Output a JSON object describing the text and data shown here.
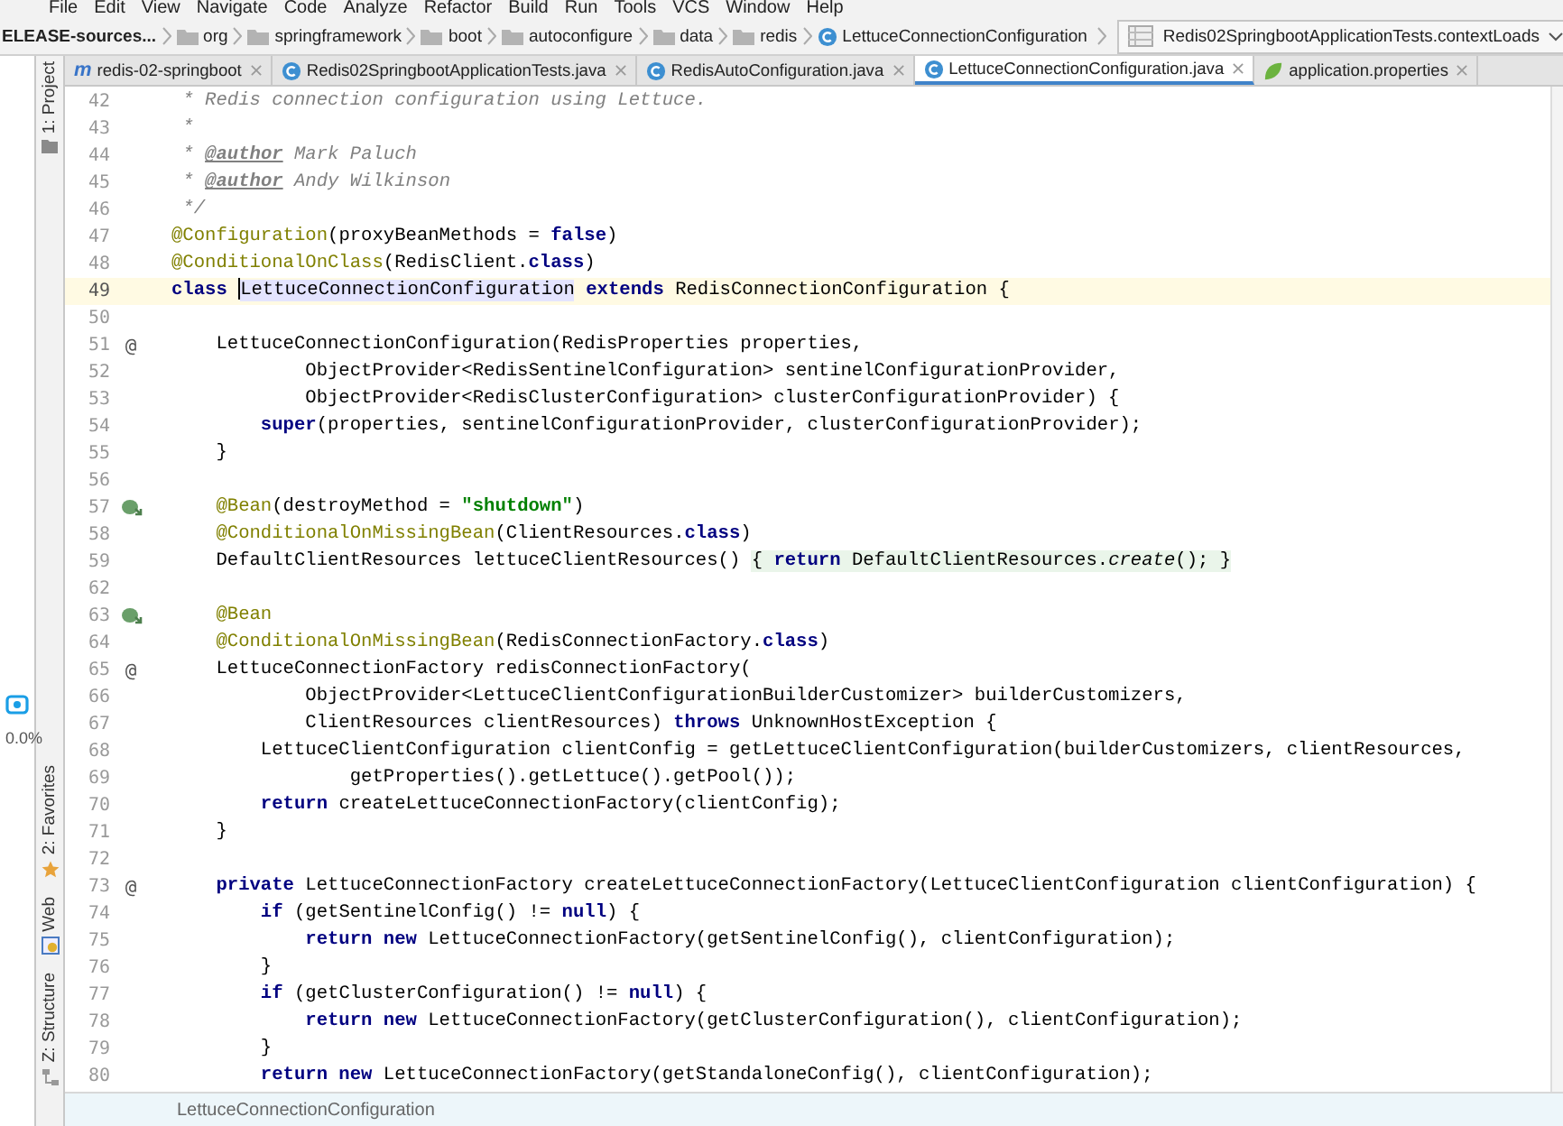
{
  "menu": [
    "File",
    "Edit",
    "View",
    "Navigate",
    "Code",
    "Analyze",
    "Refactor",
    "Build",
    "Run",
    "Tools",
    "VCS",
    "Window",
    "Help"
  ],
  "breadcrumb": [
    {
      "kind": "root",
      "text": "ELEASE-sources..."
    },
    {
      "kind": "folder",
      "text": "org"
    },
    {
      "kind": "folder",
      "text": "springframework"
    },
    {
      "kind": "folder",
      "text": "boot"
    },
    {
      "kind": "folder",
      "text": "autoconfigure"
    },
    {
      "kind": "folder",
      "text": "data"
    },
    {
      "kind": "folder",
      "text": "redis"
    },
    {
      "kind": "class",
      "text": "LettuceConnectionConfiguration"
    }
  ],
  "run_config": "Redis02SpringbootApplicationTests.contextLoads",
  "tabs": [
    {
      "kind": "module",
      "glyph": "m",
      "label": "redis-02-springboot",
      "selected": false
    },
    {
      "kind": "class",
      "label": "Redis02SpringbootApplicationTests.java",
      "selected": false
    },
    {
      "kind": "class",
      "label": "RedisAutoConfiguration.java",
      "selected": false
    },
    {
      "kind": "class",
      "label": "LettuceConnectionConfiguration.java",
      "selected": true
    },
    {
      "kind": "properties",
      "label": "application.properties",
      "selected": false
    }
  ],
  "tool_windows": [
    {
      "kind": "project",
      "label": "1: Project"
    },
    {
      "kind": "favorites",
      "label": "2: Favorites"
    },
    {
      "kind": "web",
      "label": "Web"
    },
    {
      "kind": "structure",
      "label": "Z: Structure"
    }
  ],
  "recorder_widget": {
    "reading": "0.0%"
  },
  "lines": [
    {
      "number": "42",
      "current": false,
      "tokens": [
        {
          "kind": "comment",
          "text": " * Redis connection configuration using Lettuce."
        }
      ]
    },
    {
      "number": "43",
      "current": false,
      "tokens": [
        {
          "kind": "comment",
          "text": " *"
        }
      ]
    },
    {
      "number": "44",
      "current": false,
      "tokens": [
        {
          "kind": "comment",
          "text": " * "
        },
        {
          "kind": "doctag",
          "text": "@author"
        },
        {
          "kind": "comment",
          "text": " Mark Paluch"
        }
      ]
    },
    {
      "number": "45",
      "current": false,
      "tokens": [
        {
          "kind": "comment",
          "text": " * "
        },
        {
          "kind": "doctag",
          "text": "@author"
        },
        {
          "kind": "comment",
          "text": " Andy Wilkinson"
        }
      ]
    },
    {
      "number": "46",
      "current": false,
      "tokens": [
        {
          "kind": "comment",
          "text": " */"
        }
      ]
    },
    {
      "number": "47",
      "current": false,
      "tokens": [
        {
          "kind": "annotation",
          "text": "@Configuration"
        },
        {
          "kind": "plain",
          "text": "(proxyBeanMethods = "
        },
        {
          "kind": "keyword",
          "text": "false"
        },
        {
          "kind": "plain",
          "text": ")"
        }
      ]
    },
    {
      "number": "48",
      "current": false,
      "tokens": [
        {
          "kind": "annotation",
          "text": "@ConditionalOnClass"
        },
        {
          "kind": "plain",
          "text": "(RedisClient."
        },
        {
          "kind": "keyword",
          "text": "class"
        },
        {
          "kind": "plain",
          "text": ")"
        }
      ]
    },
    {
      "number": "49",
      "current": true,
      "tokens": [
        {
          "kind": "keyword",
          "text": "class "
        },
        {
          "kind": "selected",
          "text": "LettuceConnectionConfiguration"
        },
        {
          "kind": "keyword",
          "text": " extends"
        },
        {
          "kind": "plain",
          "text": " RedisConnectionConfiguration {"
        }
      ]
    },
    {
      "number": "50",
      "current": false
    },
    {
      "number": "51",
      "current": false,
      "gutter": {
        "kind": "text",
        "text": "@"
      },
      "tokens": [
        {
          "kind": "plain",
          "text": "    LettuceConnectionConfiguration(RedisProperties properties,"
        }
      ]
    },
    {
      "number": "52",
      "current": false,
      "tokens": [
        {
          "kind": "plain",
          "text": "            ObjectProvider<RedisSentinelConfiguration> sentinelConfigurationProvider,"
        }
      ]
    },
    {
      "number": "53",
      "current": false,
      "tokens": [
        {
          "kind": "plain",
          "text": "            ObjectProvider<RedisClusterConfiguration> clusterConfigurationProvider) {"
        }
      ]
    },
    {
      "number": "54",
      "current": false,
      "tokens": [
        {
          "kind": "keyword",
          "text": "        super"
        },
        {
          "kind": "plain",
          "text": "(properties, sentinelConfigurationProvider, clusterConfigurationProvider);"
        }
      ]
    },
    {
      "number": "55",
      "current": false,
      "tokens": [
        {
          "kind": "plain",
          "text": "    }"
        }
      ]
    },
    {
      "number": "56",
      "current": false
    },
    {
      "number": "57",
      "current": false,
      "gutter": {
        "kind": "bean"
      },
      "tokens": [
        {
          "kind": "annotation",
          "text": "    @Bean"
        },
        {
          "kind": "plain",
          "text": "(destroyMethod = "
        },
        {
          "kind": "string",
          "text": "\"shutdown\""
        },
        {
          "kind": "plain",
          "text": ")"
        }
      ]
    },
    {
      "number": "58",
      "current": false,
      "tokens": [
        {
          "kind": "annotation",
          "text": "    @ConditionalOnMissingBean"
        },
        {
          "kind": "plain",
          "text": "(ClientResources."
        },
        {
          "kind": "keyword",
          "text": "class"
        },
        {
          "kind": "plain",
          "text": ")"
        }
      ]
    },
    {
      "number": "59",
      "current": false,
      "tokens": [
        {
          "kind": "plain",
          "text": "    DefaultClientResources lettuceClientResources() "
        }
      ],
      "folded": [
        {
          "kind": "plain",
          "text": "{ "
        },
        {
          "kind": "keyword",
          "text": "return"
        },
        {
          "kind": "plain",
          "text": " DefaultClientResources."
        },
        {
          "kind": "italic",
          "text": "create"
        },
        {
          "kind": "plain",
          "text": "(); }"
        }
      ]
    },
    {
      "number": "62",
      "current": false
    },
    {
      "number": "63",
      "current": false,
      "gutter": {
        "kind": "bean"
      },
      "tokens": [
        {
          "kind": "annotation",
          "text": "    @Bean"
        }
      ]
    },
    {
      "number": "64",
      "current": false,
      "tokens": [
        {
          "kind": "annotation",
          "text": "    @ConditionalOnMissingBean"
        },
        {
          "kind": "plain",
          "text": "(RedisConnectionFactory."
        },
        {
          "kind": "keyword",
          "text": "class"
        },
        {
          "kind": "plain",
          "text": ")"
        }
      ]
    },
    {
      "number": "65",
      "current": false,
      "gutter": {
        "kind": "text",
        "text": "@"
      },
      "tokens": [
        {
          "kind": "plain",
          "text": "    LettuceConnectionFactory redisConnectionFactory("
        }
      ]
    },
    {
      "number": "66",
      "current": false,
      "tokens": [
        {
          "kind": "plain",
          "text": "            ObjectProvider<LettuceClientConfigurationBuilderCustomizer> builderCustomizers,"
        }
      ]
    },
    {
      "number": "67",
      "current": false,
      "tokens": [
        {
          "kind": "plain",
          "text": "            ClientResources clientResources) "
        },
        {
          "kind": "keyword",
          "text": "throws"
        },
        {
          "kind": "plain",
          "text": " UnknownHostException {"
        }
      ]
    },
    {
      "number": "68",
      "current": false,
      "tokens": [
        {
          "kind": "plain",
          "text": "        LettuceClientConfiguration clientConfig = getLettuceClientConfiguration(builderCustomizers, clientResources,"
        }
      ]
    },
    {
      "number": "69",
      "current": false,
      "tokens": [
        {
          "kind": "plain",
          "text": "                getProperties().getLettuce().getPool());"
        }
      ]
    },
    {
      "number": "70",
      "current": false,
      "tokens": [
        {
          "kind": "keyword",
          "text": "        return"
        },
        {
          "kind": "plain",
          "text": " createLettuceConnectionFactory(clientConfig);"
        }
      ]
    },
    {
      "number": "71",
      "current": false,
      "tokens": [
        {
          "kind": "plain",
          "text": "    }"
        }
      ]
    },
    {
      "number": "72",
      "current": false
    },
    {
      "number": "73",
      "current": false,
      "gutter": {
        "kind": "text",
        "text": "@"
      },
      "tokens": [
        {
          "kind": "keyword",
          "text": "    private"
        },
        {
          "kind": "plain",
          "text": " LettuceConnectionFactory createLettuceConnectionFactory(LettuceClientConfiguration clientConfiguration) {"
        }
      ]
    },
    {
      "number": "74",
      "current": false,
      "tokens": [
        {
          "kind": "keyword",
          "text": "        if"
        },
        {
          "kind": "plain",
          "text": " (getSentinelConfig() != "
        },
        {
          "kind": "keyword",
          "text": "null"
        },
        {
          "kind": "plain",
          "text": ") {"
        }
      ]
    },
    {
      "number": "75",
      "current": false,
      "tokens": [
        {
          "kind": "keyword",
          "text": "            return new"
        },
        {
          "kind": "plain",
          "text": " LettuceConnectionFactory(getSentinelConfig(), clientConfiguration);"
        }
      ]
    },
    {
      "number": "76",
      "current": false,
      "tokens": [
        {
          "kind": "plain",
          "text": "        }"
        }
      ]
    },
    {
      "number": "77",
      "current": false,
      "tokens": [
        {
          "kind": "keyword",
          "text": "        if"
        },
        {
          "kind": "plain",
          "text": " (getClusterConfiguration() != "
        },
        {
          "kind": "keyword",
          "text": "null"
        },
        {
          "kind": "plain",
          "text": ") {"
        }
      ]
    },
    {
      "number": "78",
      "current": false,
      "tokens": [
        {
          "kind": "keyword",
          "text": "            return new"
        },
        {
          "kind": "plain",
          "text": " LettuceConnectionFactory(getClusterConfiguration(), clientConfiguration);"
        }
      ]
    },
    {
      "number": "79",
      "current": false,
      "tokens": [
        {
          "kind": "plain",
          "text": "        }"
        }
      ]
    },
    {
      "number": "80",
      "current": false,
      "tokens": [
        {
          "kind": "keyword",
          "text": "        return new"
        },
        {
          "kind": "plain",
          "text": " LettuceConnectionFactory(getStandaloneConfig(), clientConfiguration);"
        }
      ]
    }
  ],
  "editor_breadcrumb": "LettuceConnectionConfiguration"
}
